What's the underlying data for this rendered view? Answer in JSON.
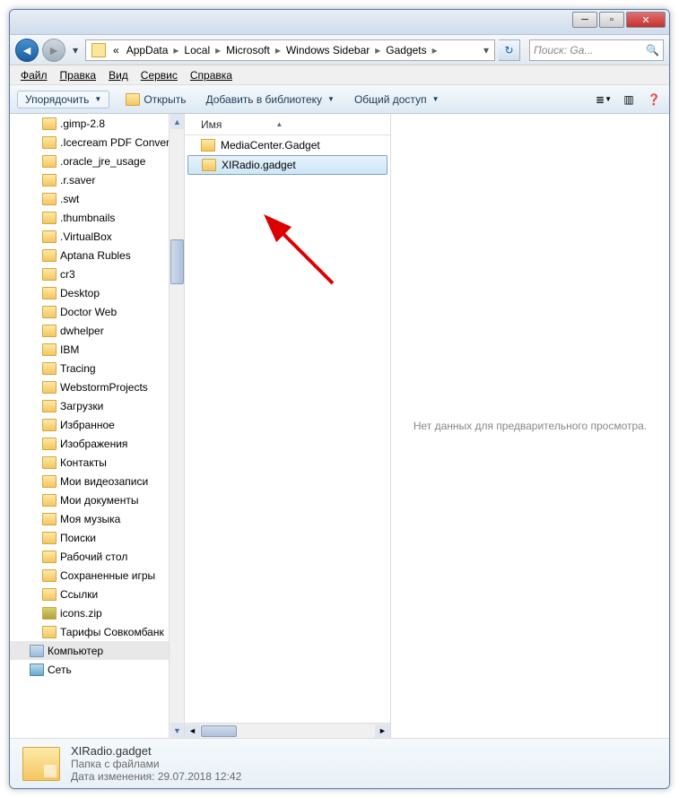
{
  "breadcrumbs": [
    "AppData",
    "Local",
    "Microsoft",
    "Windows Sidebar",
    "Gadgets"
  ],
  "search_placeholder": "Поиск: Ga...",
  "menu": {
    "file": "Файл",
    "edit": "Правка",
    "view": "Вид",
    "tools": "Сервис",
    "help": "Справка"
  },
  "toolbar": {
    "organize": "Упорядочить",
    "open": "Открыть",
    "addlib": "Добавить в библиотеку",
    "share": "Общий доступ"
  },
  "column_header": "Имя",
  "tree_items": [
    {
      "label": ".gimp-2.8",
      "ico": "folder"
    },
    {
      "label": ".Icecream PDF Conver",
      "ico": "folder"
    },
    {
      "label": ".oracle_jre_usage",
      "ico": "folder"
    },
    {
      "label": ".r.saver",
      "ico": "folder"
    },
    {
      "label": ".swt",
      "ico": "folder"
    },
    {
      "label": ".thumbnails",
      "ico": "folder"
    },
    {
      "label": ".VirtualBox",
      "ico": "folder"
    },
    {
      "label": "Aptana Rubles",
      "ico": "folder"
    },
    {
      "label": "cr3",
      "ico": "folder"
    },
    {
      "label": "Desktop",
      "ico": "folder"
    },
    {
      "label": "Doctor Web",
      "ico": "folder"
    },
    {
      "label": "dwhelper",
      "ico": "folder"
    },
    {
      "label": "IBM",
      "ico": "folder"
    },
    {
      "label": "Tracing",
      "ico": "folder"
    },
    {
      "label": "WebstormProjects",
      "ico": "folder"
    },
    {
      "label": "Загрузки",
      "ico": "folder"
    },
    {
      "label": "Избранное",
      "ico": "folder"
    },
    {
      "label": "Изображения",
      "ico": "folder"
    },
    {
      "label": "Контакты",
      "ico": "folder"
    },
    {
      "label": "Мои видеозаписи",
      "ico": "folder"
    },
    {
      "label": "Мои документы",
      "ico": "folder"
    },
    {
      "label": "Моя музыка",
      "ico": "folder"
    },
    {
      "label": "Поиски",
      "ico": "folder"
    },
    {
      "label": "Рабочий стол",
      "ico": "folder"
    },
    {
      "label": "Сохраненные игры",
      "ico": "folder"
    },
    {
      "label": "Ссылки",
      "ico": "folder"
    },
    {
      "label": "icons.zip",
      "ico": "zip"
    },
    {
      "label": "Тарифы Совкомбанк",
      "ico": "folder"
    },
    {
      "label": "Компьютер",
      "ico": "mon",
      "indent": 0,
      "sel": true
    },
    {
      "label": "Сеть",
      "ico": "net",
      "indent": 0
    }
  ],
  "files": [
    {
      "name": "MediaCenter.Gadget",
      "selected": false
    },
    {
      "name": "XIRadio.gadget",
      "selected": true
    }
  ],
  "preview_text": "Нет данных для предварительного просмотра.",
  "details": {
    "name": "XIRadio.gadget",
    "type": "Папка с файлами",
    "date_label": "Дата изменения:",
    "date_value": "29.07.2018 12:42"
  }
}
